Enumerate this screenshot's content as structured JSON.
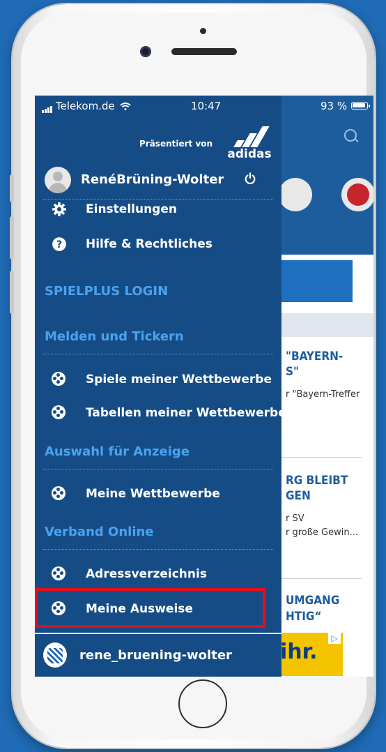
{
  "status_bar": {
    "carrier": "Telekom.de",
    "time": "10:47",
    "battery": "93 %"
  },
  "drawer": {
    "sponsor_label": "Präsentiert von",
    "sponsor_name": "adidas",
    "user_name": "RenéBrüning-Wolter",
    "items_top": [
      {
        "label": "Einstellungen",
        "icon": "gear-icon"
      },
      {
        "label": "Hilfe & Rechtliches",
        "icon": "help-icon"
      }
    ],
    "sections": {
      "spielplus": "SPIELPLUS LOGIN",
      "melden": "Melden und Tickern",
      "auswahl": "Auswahl für Anzeige",
      "verband": "Verband Online"
    },
    "melden_items": [
      {
        "label": "Spiele meiner Wettbewerbe",
        "icon": "football-icon"
      },
      {
        "label": "Tabellen meiner Wettbewerbe",
        "icon": "football-icon"
      }
    ],
    "auswahl_items": [
      {
        "label": "Meine Wettbewerbe",
        "icon": "football-icon"
      }
    ],
    "verband_items": [
      {
        "label": "Adressverzeichnis",
        "icon": "football-icon"
      },
      {
        "label": "Meine Ausweise",
        "icon": "football-icon"
      }
    ],
    "footer_username": "rene_bruening-wolter"
  },
  "background": {
    "news1_title_l1": "\"BAYERN-",
    "news1_title_l2": "S\"",
    "news1_sub": "r \"Bayern-Treffer",
    "news2_title_l1": "RG BLEIBT",
    "news2_title_l2": "GEN",
    "news2_sub_l1": "r SV",
    "news2_sub_l2": "r große Gewin...",
    "news3_title_l1": "UMGANG",
    "news3_title_l2": "HTIG“",
    "ad_text": "ihr."
  },
  "colors": {
    "drawer_bg": "#164c86",
    "section_text": "#4aa3f0",
    "highlight_border": "#e3101b"
  }
}
